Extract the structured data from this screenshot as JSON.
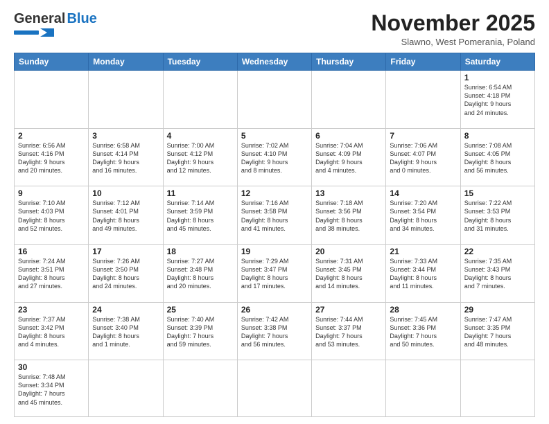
{
  "header": {
    "logo_general": "General",
    "logo_blue": "Blue",
    "month_title": "November 2025",
    "subtitle": "Slawno, West Pomerania, Poland"
  },
  "weekdays": [
    "Sunday",
    "Monday",
    "Tuesday",
    "Wednesday",
    "Thursday",
    "Friday",
    "Saturday"
  ],
  "weeks": [
    [
      {
        "day": "",
        "info": ""
      },
      {
        "day": "",
        "info": ""
      },
      {
        "day": "",
        "info": ""
      },
      {
        "day": "",
        "info": ""
      },
      {
        "day": "",
        "info": ""
      },
      {
        "day": "",
        "info": ""
      },
      {
        "day": "1",
        "info": "Sunrise: 6:54 AM\nSunset: 4:18 PM\nDaylight: 9 hours\nand 24 minutes."
      }
    ],
    [
      {
        "day": "2",
        "info": "Sunrise: 6:56 AM\nSunset: 4:16 PM\nDaylight: 9 hours\nand 20 minutes."
      },
      {
        "day": "3",
        "info": "Sunrise: 6:58 AM\nSunset: 4:14 PM\nDaylight: 9 hours\nand 16 minutes."
      },
      {
        "day": "4",
        "info": "Sunrise: 7:00 AM\nSunset: 4:12 PM\nDaylight: 9 hours\nand 12 minutes."
      },
      {
        "day": "5",
        "info": "Sunrise: 7:02 AM\nSunset: 4:10 PM\nDaylight: 9 hours\nand 8 minutes."
      },
      {
        "day": "6",
        "info": "Sunrise: 7:04 AM\nSunset: 4:09 PM\nDaylight: 9 hours\nand 4 minutes."
      },
      {
        "day": "7",
        "info": "Sunrise: 7:06 AM\nSunset: 4:07 PM\nDaylight: 9 hours\nand 0 minutes."
      },
      {
        "day": "8",
        "info": "Sunrise: 7:08 AM\nSunset: 4:05 PM\nDaylight: 8 hours\nand 56 minutes."
      }
    ],
    [
      {
        "day": "9",
        "info": "Sunrise: 7:10 AM\nSunset: 4:03 PM\nDaylight: 8 hours\nand 52 minutes."
      },
      {
        "day": "10",
        "info": "Sunrise: 7:12 AM\nSunset: 4:01 PM\nDaylight: 8 hours\nand 49 minutes."
      },
      {
        "day": "11",
        "info": "Sunrise: 7:14 AM\nSunset: 3:59 PM\nDaylight: 8 hours\nand 45 minutes."
      },
      {
        "day": "12",
        "info": "Sunrise: 7:16 AM\nSunset: 3:58 PM\nDaylight: 8 hours\nand 41 minutes."
      },
      {
        "day": "13",
        "info": "Sunrise: 7:18 AM\nSunset: 3:56 PM\nDaylight: 8 hours\nand 38 minutes."
      },
      {
        "day": "14",
        "info": "Sunrise: 7:20 AM\nSunset: 3:54 PM\nDaylight: 8 hours\nand 34 minutes."
      },
      {
        "day": "15",
        "info": "Sunrise: 7:22 AM\nSunset: 3:53 PM\nDaylight: 8 hours\nand 31 minutes."
      }
    ],
    [
      {
        "day": "16",
        "info": "Sunrise: 7:24 AM\nSunset: 3:51 PM\nDaylight: 8 hours\nand 27 minutes."
      },
      {
        "day": "17",
        "info": "Sunrise: 7:26 AM\nSunset: 3:50 PM\nDaylight: 8 hours\nand 24 minutes."
      },
      {
        "day": "18",
        "info": "Sunrise: 7:27 AM\nSunset: 3:48 PM\nDaylight: 8 hours\nand 20 minutes."
      },
      {
        "day": "19",
        "info": "Sunrise: 7:29 AM\nSunset: 3:47 PM\nDaylight: 8 hours\nand 17 minutes."
      },
      {
        "day": "20",
        "info": "Sunrise: 7:31 AM\nSunset: 3:45 PM\nDaylight: 8 hours\nand 14 minutes."
      },
      {
        "day": "21",
        "info": "Sunrise: 7:33 AM\nSunset: 3:44 PM\nDaylight: 8 hours\nand 11 minutes."
      },
      {
        "day": "22",
        "info": "Sunrise: 7:35 AM\nSunset: 3:43 PM\nDaylight: 8 hours\nand 7 minutes."
      }
    ],
    [
      {
        "day": "23",
        "info": "Sunrise: 7:37 AM\nSunset: 3:42 PM\nDaylight: 8 hours\nand 4 minutes."
      },
      {
        "day": "24",
        "info": "Sunrise: 7:38 AM\nSunset: 3:40 PM\nDaylight: 8 hours\nand 1 minute."
      },
      {
        "day": "25",
        "info": "Sunrise: 7:40 AM\nSunset: 3:39 PM\nDaylight: 7 hours\nand 59 minutes."
      },
      {
        "day": "26",
        "info": "Sunrise: 7:42 AM\nSunset: 3:38 PM\nDaylight: 7 hours\nand 56 minutes."
      },
      {
        "day": "27",
        "info": "Sunrise: 7:44 AM\nSunset: 3:37 PM\nDaylight: 7 hours\nand 53 minutes."
      },
      {
        "day": "28",
        "info": "Sunrise: 7:45 AM\nSunset: 3:36 PM\nDaylight: 7 hours\nand 50 minutes."
      },
      {
        "day": "29",
        "info": "Sunrise: 7:47 AM\nSunset: 3:35 PM\nDaylight: 7 hours\nand 48 minutes."
      }
    ],
    [
      {
        "day": "30",
        "info": "Sunrise: 7:48 AM\nSunset: 3:34 PM\nDaylight: 7 hours\nand 45 minutes."
      },
      {
        "day": "",
        "info": ""
      },
      {
        "day": "",
        "info": ""
      },
      {
        "day": "",
        "info": ""
      },
      {
        "day": "",
        "info": ""
      },
      {
        "day": "",
        "info": ""
      },
      {
        "day": "",
        "info": ""
      }
    ]
  ]
}
